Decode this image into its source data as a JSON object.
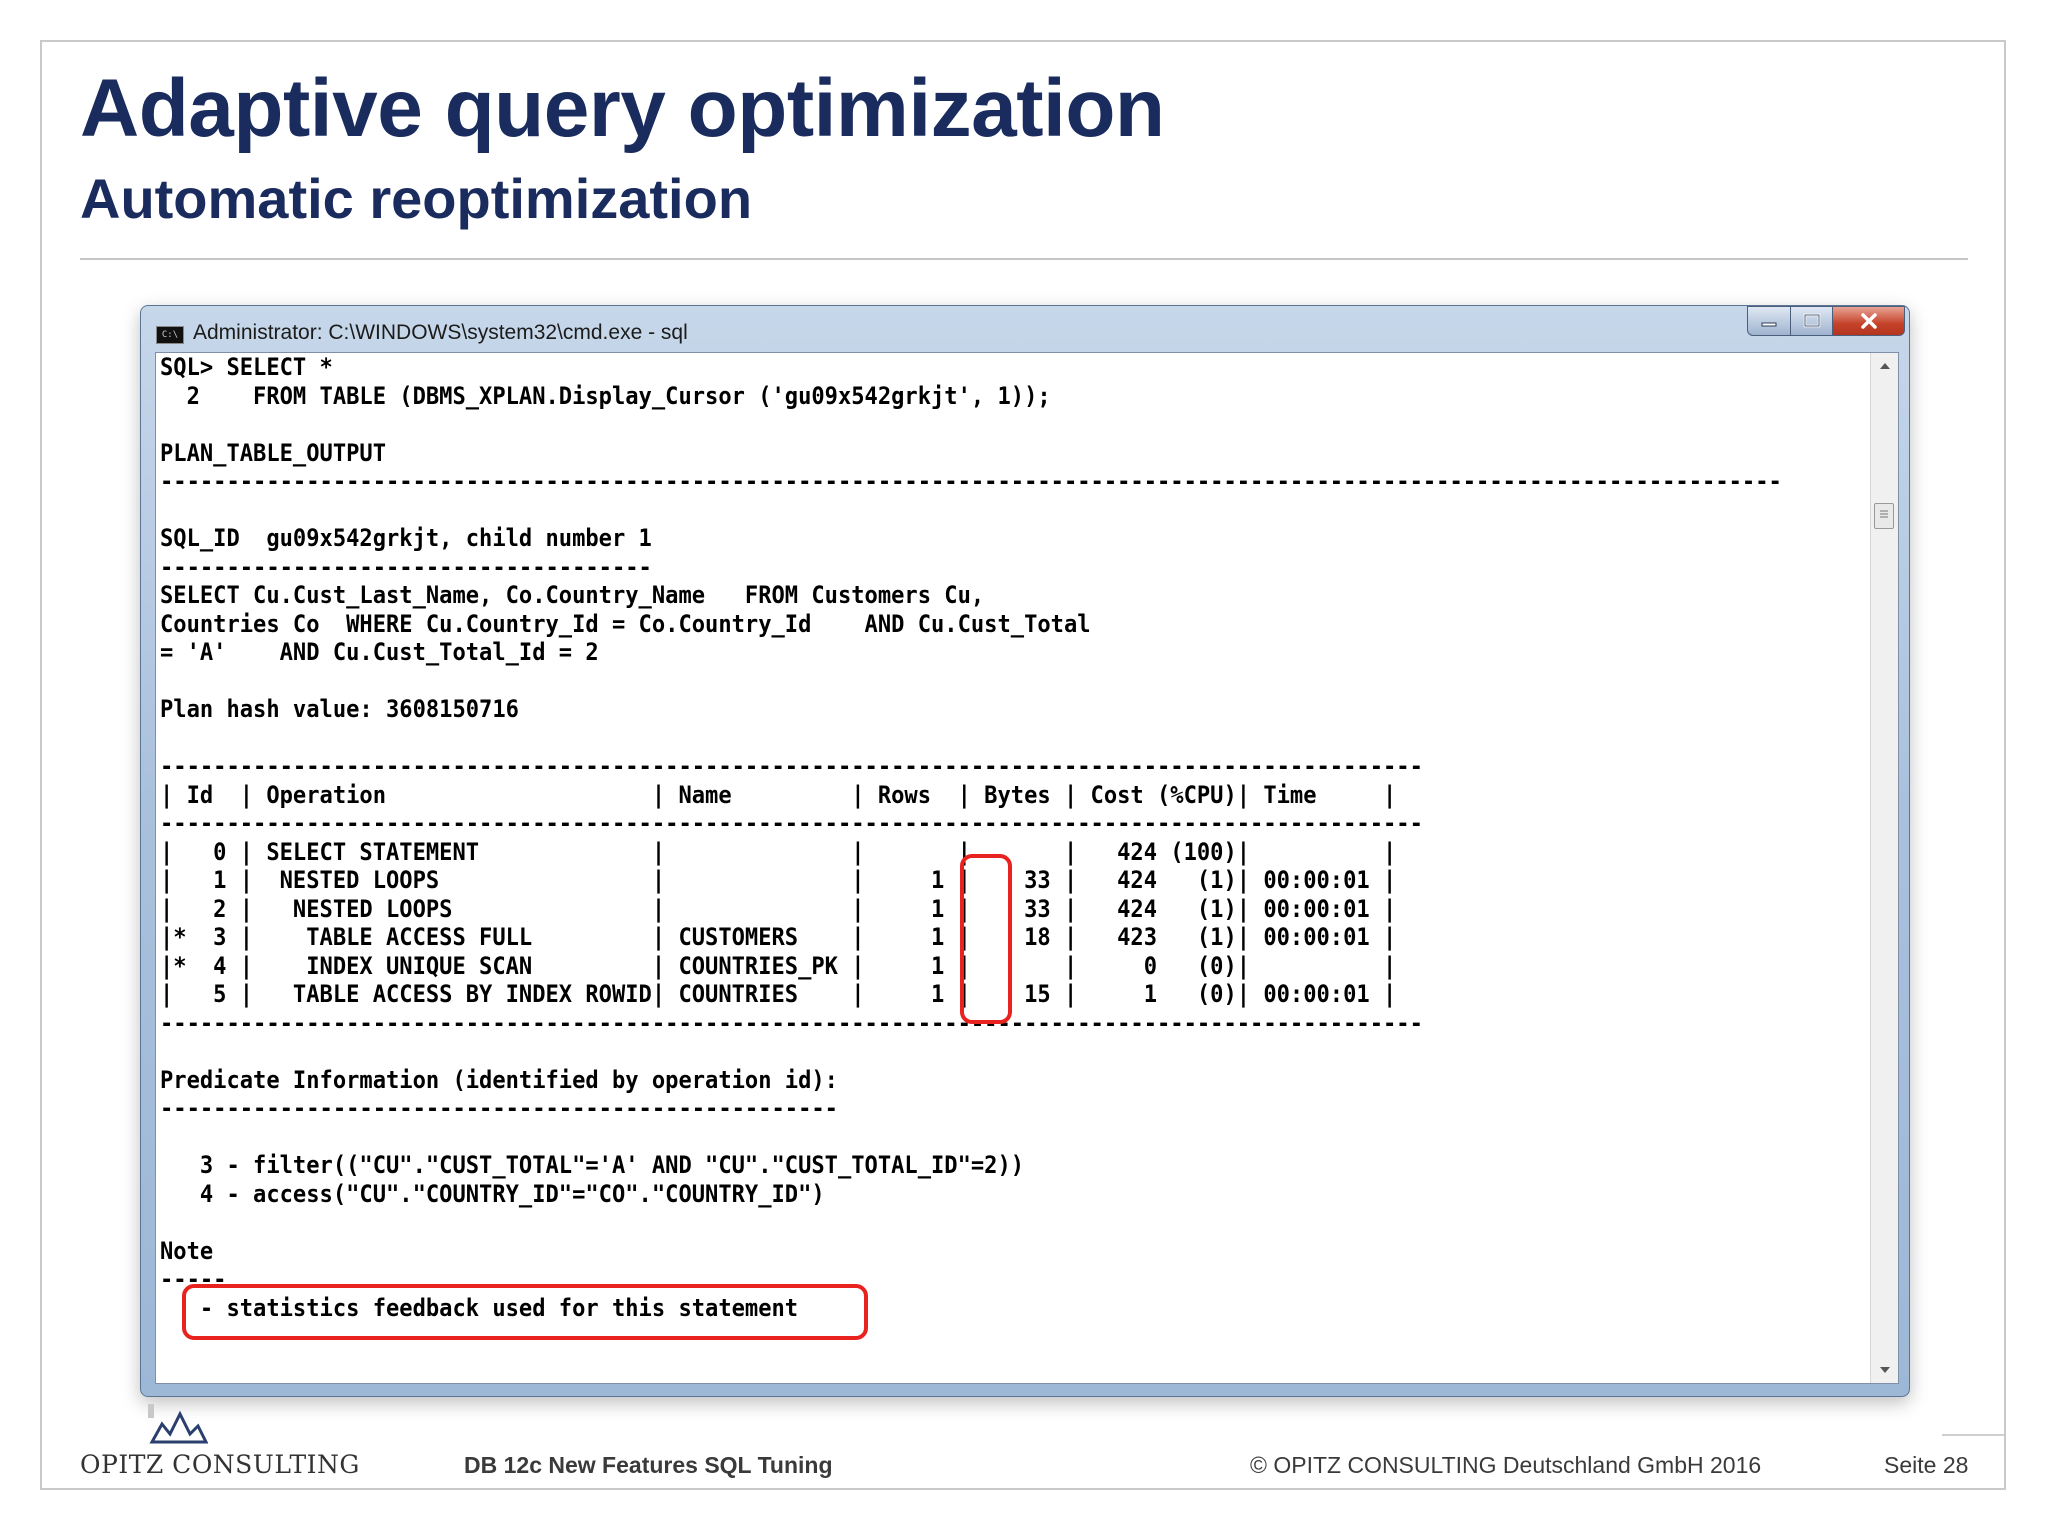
{
  "slide": {
    "title": "Adaptive query optimization",
    "subtitle": "Automatic reoptimization"
  },
  "window": {
    "icon_label": "C:\\",
    "title": "Administrator: C:\\WINDOWS\\system32\\cmd.exe - sql",
    "minimize_icon": "minimize-icon",
    "maximize_icon": "maximize-icon",
    "close_icon": "close-icon"
  },
  "console": {
    "lines": [
      "SQL> SELECT *",
      "  2    FROM TABLE (DBMS_XPLAN.Display_Cursor ('gu09x542grkjt', 1));",
      "",
      "PLAN_TABLE_OUTPUT",
      "--------------------------------------------------------------------------------------------------------------------------",
      "",
      "SQL_ID  gu09x542grkjt, child number 1",
      "-------------------------------------",
      "SELECT Cu.Cust_Last_Name, Co.Country_Name   FROM Customers Cu,",
      "Countries Co  WHERE Cu.Country_Id = Co.Country_Id    AND Cu.Cust_Total",
      "= 'A'    AND Cu.Cust_Total_Id = 2",
      "",
      "Plan hash value: 3608150716",
      "",
      "-----------------------------------------------------------------------------------------------",
      "| Id  | Operation                    | Name         | Rows  | Bytes | Cost (%CPU)| Time     |",
      "-----------------------------------------------------------------------------------------------",
      "|   0 | SELECT STATEMENT             |              |       |       |   424 (100)|          |",
      "|   1 |  NESTED LOOPS                |              |     1 |    33 |   424   (1)| 00:00:01 |",
      "|   2 |   NESTED LOOPS               |              |     1 |    33 |   424   (1)| 00:00:01 |",
      "|*  3 |    TABLE ACCESS FULL         | CUSTOMERS    |     1 |    18 |   423   (1)| 00:00:01 |",
      "|*  4 |    INDEX UNIQUE SCAN         | COUNTRIES_PK |     1 |       |     0   (0)|          |",
      "|   5 |   TABLE ACCESS BY INDEX ROWID| COUNTRIES    |     1 |    15 |     1   (0)| 00:00:01 |",
      "-----------------------------------------------------------------------------------------------",
      "",
      "Predicate Information (identified by operation id):",
      "---------------------------------------------------",
      "",
      "   3 - filter((\"CU\".\"CUST_TOTAL\"='A' AND \"CU\".\"CUST_TOTAL_ID\"=2))",
      "   4 - access(\"CU\".\"COUNTRY_ID\"=\"CO\".\"COUNTRY_ID\")",
      "",
      "Note",
      "-----",
      "   - statistics feedback used for this statement"
    ]
  },
  "footer": {
    "logo_text": "OPITZ CONSULTING",
    "center_text": "DB 12c New Features SQL Tuning",
    "copyright": "© OPITZ CONSULTING Deutschland GmbH 2016",
    "page": "Seite 28"
  },
  "colors": {
    "title": "#1a2c5e",
    "highlight": "#e8231f"
  }
}
